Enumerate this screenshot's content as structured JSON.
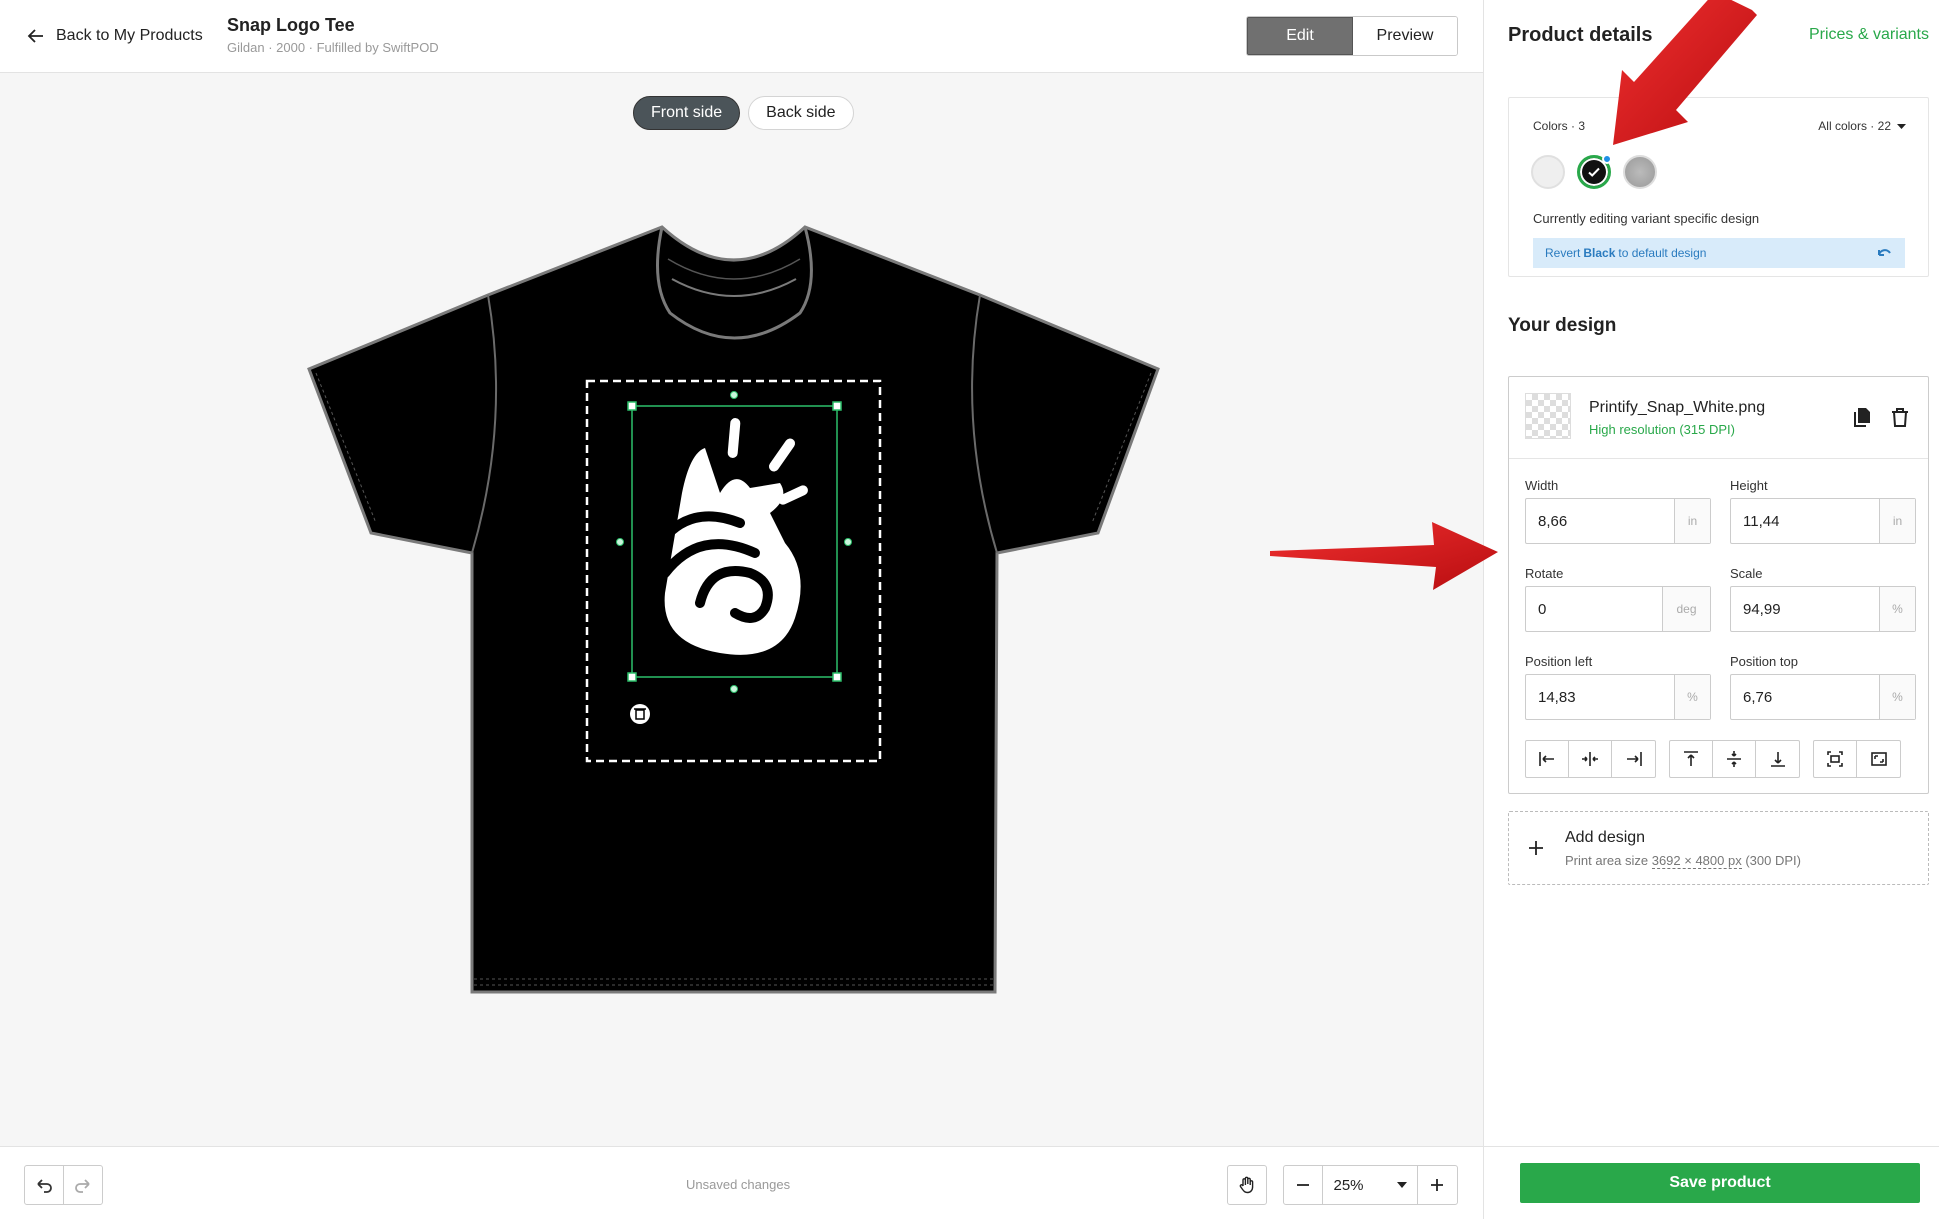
{
  "header": {
    "back_label": "Back to My Products",
    "product_title": "Snap Logo Tee",
    "product_subtitle": "Gildan · 2000 · Fulfilled by SwiftPOD",
    "edit_label": "Edit",
    "preview_label": "Preview"
  },
  "canvas": {
    "front_label": "Front side",
    "back_label": "Back side",
    "tee_color": "#000000"
  },
  "bottom": {
    "unsaved_text": "Unsaved changes",
    "zoom_value": "25%",
    "icons": [
      "undo-icon",
      "redo-icon",
      "hand-icon",
      "minus-icon",
      "chevron-down-icon",
      "plus-icon"
    ]
  },
  "panel": {
    "title": "Product details",
    "prices_link": "Prices & variants",
    "colors": {
      "count_label": "Colors · 3",
      "all_colors_label": "All colors · 22",
      "swatches": [
        {
          "name": "White",
          "hex": "#efefef"
        },
        {
          "name": "Black",
          "hex": "#111111",
          "selected": true
        },
        {
          "name": "Sport Grey",
          "hex": "#a8a8a8"
        }
      ],
      "editing_note": "Currently editing variant specific design",
      "revert_prefix": "Revert",
      "revert_color": "Black",
      "revert_suffix": "to default design"
    },
    "your_design_title": "Your design",
    "design": {
      "file_name": "Printify_Snap_White.png",
      "resolution": "High resolution (315 DPI)",
      "width_label": "Width",
      "width_value": "8,66",
      "width_unit": "in",
      "height_label": "Height",
      "height_value": "11,44",
      "height_unit": "in",
      "rotate_label": "Rotate",
      "rotate_value": "0",
      "rotate_unit": "deg",
      "scale_label": "Scale",
      "scale_value": "94,99",
      "scale_unit": "%",
      "left_label": "Position left",
      "left_value": "14,83",
      "left_unit": "%",
      "top_label": "Position top",
      "top_value": "6,76",
      "top_unit": "%"
    },
    "add_design": {
      "title": "Add design",
      "sub_prefix": "Print area size",
      "sub_dims": "3692 × 4800 px",
      "sub_suffix": "(300 DPI)"
    },
    "save_label": "Save product"
  },
  "colors": {
    "accent_green": "#29a84a",
    "annotation_red": "#e0161a",
    "info_blue": "#2a7bbf"
  }
}
